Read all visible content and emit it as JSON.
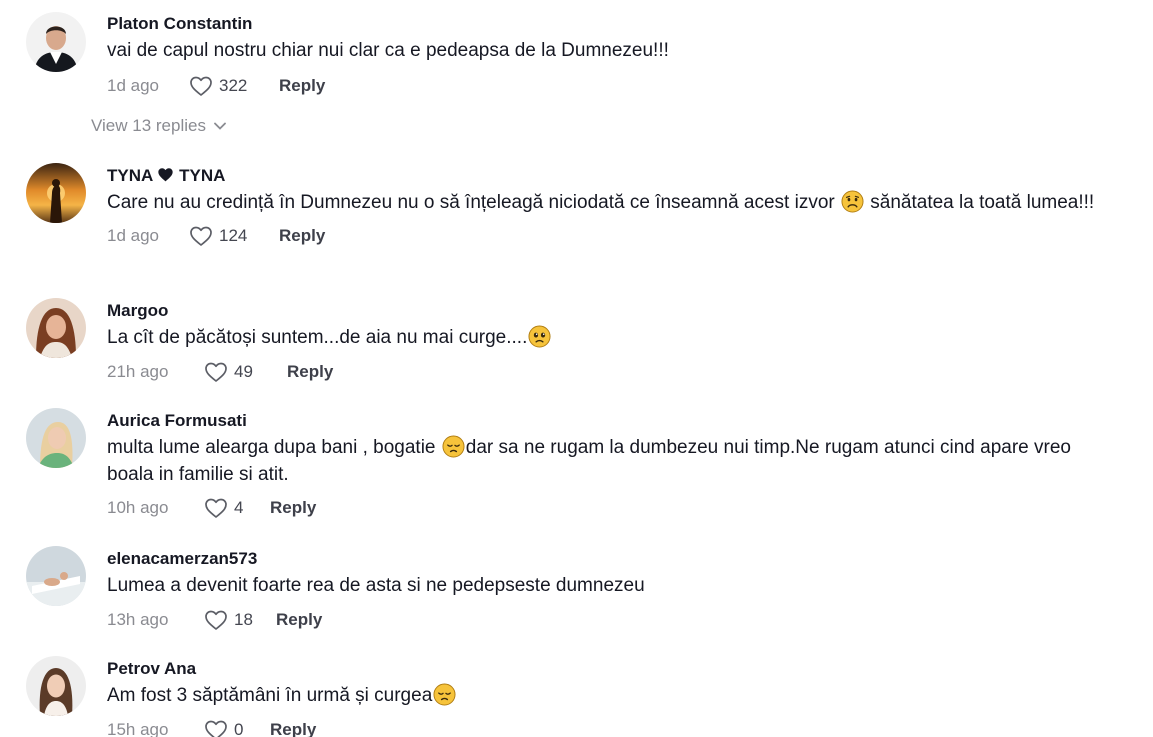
{
  "comments": [
    {
      "username": "Platon Constantin",
      "text": "vai de capul nostru chiar nui clar ca e pedeapsa de la Dumnezeu!!!",
      "time": "1d ago",
      "likes": "322",
      "reply_label": "Reply",
      "view_replies": "View 13 replies"
    },
    {
      "username_part1": "TYNA",
      "username_part2": "TYNA",
      "username_heart_icon": "black-heart-icon",
      "text_part1": "Care nu au credință în Dumnezeu nu o să înțeleagă niciodată ce înseamnă acest izvor",
      "emoji1": "sad-face-emoji",
      "text_part2": "sănătatea la toată lumea!!!",
      "time": "1d ago",
      "likes": "124",
      "reply_label": "Reply"
    },
    {
      "username": "Margoo",
      "text": "La cît de păcătoși suntem...de aia nu mai curge....",
      "emoji1": "pleading-face-emoji",
      "time": "21h ago",
      "likes": "49",
      "reply_label": "Reply"
    },
    {
      "username": "Aurica Formusati",
      "text_part1": "multa lume alearga dupa bani , bogatie",
      "emoji1": "pensive-face-emoji",
      "text_part2": "dar sa ne rugam la dumbezeu nui timp.Ne rugam atunci cind apare vreo boala in familie si atit.",
      "time": "10h ago",
      "likes": "4",
      "reply_label": "Reply"
    },
    {
      "username": "elenacamerzan573",
      "text": "Lumea a devenit foarte rea de asta si ne pedepseste dumnezeu",
      "time": "13h ago",
      "likes": "18",
      "reply_label": "Reply"
    },
    {
      "username": "Petrov Ana",
      "text": "Am fost 3 săptămâni în urmă și curgea",
      "emoji1": "pensive-face-emoji",
      "time": "15h ago",
      "likes": "0",
      "reply_label": "Reply"
    }
  ],
  "icons": {
    "like": "heart-outline-icon",
    "expand": "chevron-down-icon"
  },
  "colors": {
    "text": "#161823",
    "muted": "#8a8b91",
    "emoji_yellow": "#f6c33b"
  }
}
